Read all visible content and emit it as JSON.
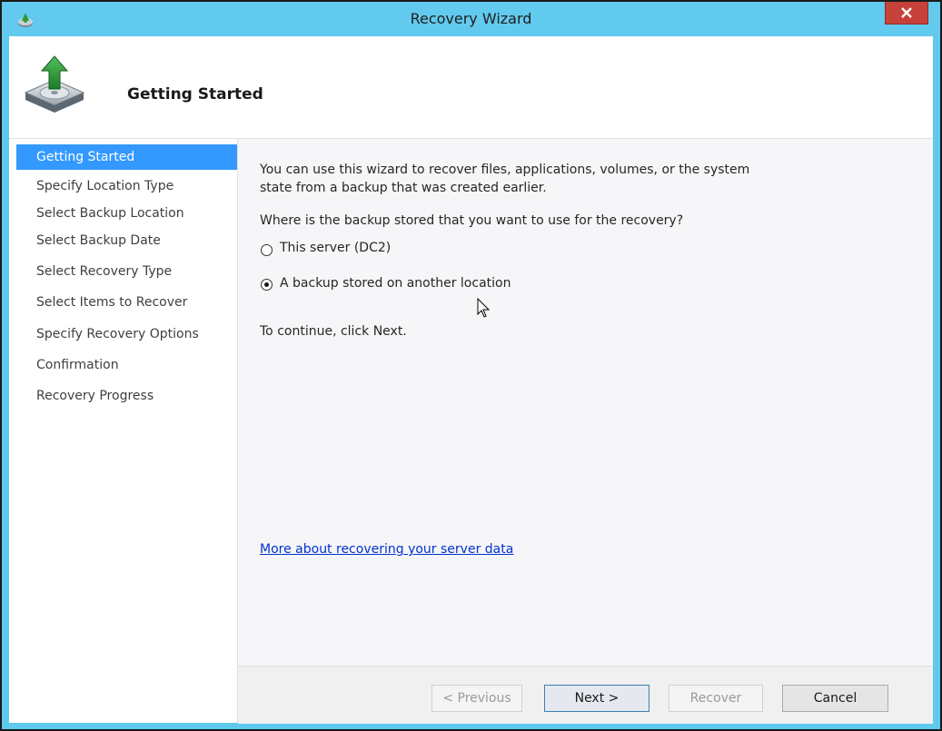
{
  "window": {
    "title": "Recovery Wizard",
    "accent_color": "#62caef",
    "icons": {
      "app": "backup-app-icon",
      "close": "close-icon",
      "header": "disk-recovery-icon"
    }
  },
  "header": {
    "title": "Getting Started"
  },
  "nav": {
    "items": [
      {
        "label": "Getting Started",
        "active": true
      },
      {
        "label": "Specify Location Type",
        "active": false
      },
      {
        "label": "Select Backup Location",
        "active": false
      },
      {
        "label": "Select Backup Date",
        "active": false
      },
      {
        "label": "Select Recovery Type",
        "active": false
      },
      {
        "label": "Select Items to Recover",
        "active": false
      },
      {
        "label": "Specify Recovery Options",
        "active": false
      },
      {
        "label": "Confirmation",
        "active": false
      },
      {
        "label": "Recovery Progress",
        "active": false
      }
    ],
    "active_color": "#3399ff"
  },
  "main": {
    "intro_line1": "You can use this wizard to recover files, applications, volumes, or the system",
    "intro_line2": "state from a backup that was created earlier.",
    "question": "Where is the backup stored that you want to use for the recovery?",
    "options": [
      {
        "label": "This server (DC2)",
        "selected": false
      },
      {
        "label": "A backup stored on another location",
        "selected": true
      }
    ],
    "continue_text": "To continue, click Next.",
    "more_link": "More about recovering your server data"
  },
  "buttons": {
    "previous": "< Previous",
    "next": "Next >",
    "recover": "Recover",
    "cancel": "Cancel"
  }
}
